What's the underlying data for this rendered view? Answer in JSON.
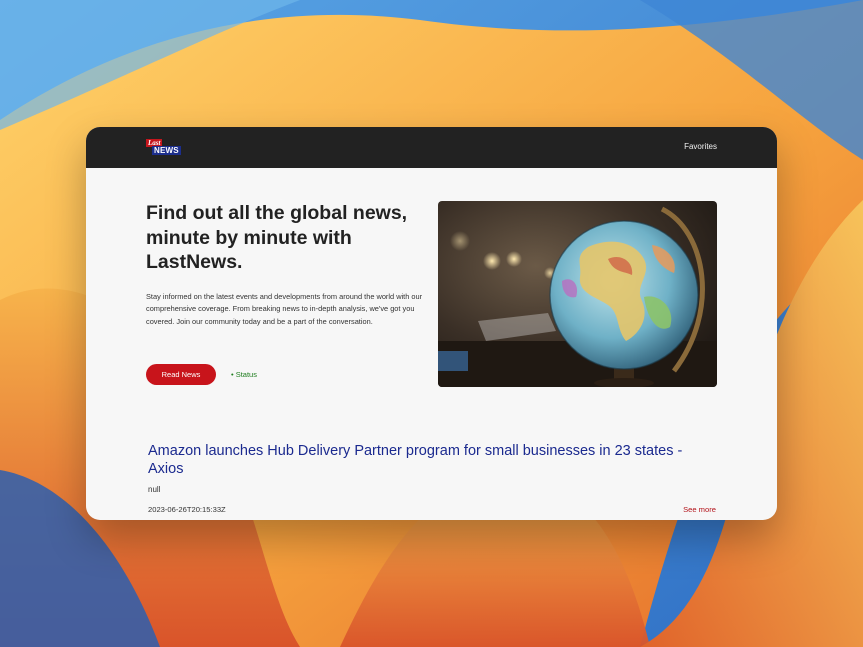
{
  "navbar": {
    "logo": {
      "top_text": "Last",
      "bottom_text": "NEWS"
    },
    "favorites_label": "Favorites"
  },
  "hero": {
    "title": "Find out all the global news, minute by minute with LastNews.",
    "description": "Stay informed on the latest events and developments from around the world with our comprehensive coverage. From breaking news to in-depth analysis, we've got you covered. Join our community today and be a part of the conversation.",
    "read_button_label": "Read News",
    "status_link_label": "• Status",
    "image_icon": "globe-photo"
  },
  "article": {
    "title": "Amazon launches Hub Delivery Partner program for small businesses in 23 states - Axios",
    "description": "null",
    "published_at": "2023-06-26T20:15:33Z",
    "see_more_label": "See more"
  },
  "colors": {
    "navbar_bg": "#222222",
    "accent_red": "#c8141b",
    "article_title_blue": "#1b2a8f",
    "status_green": "#1e7d1e",
    "page_bg": "#f7f7f7"
  }
}
